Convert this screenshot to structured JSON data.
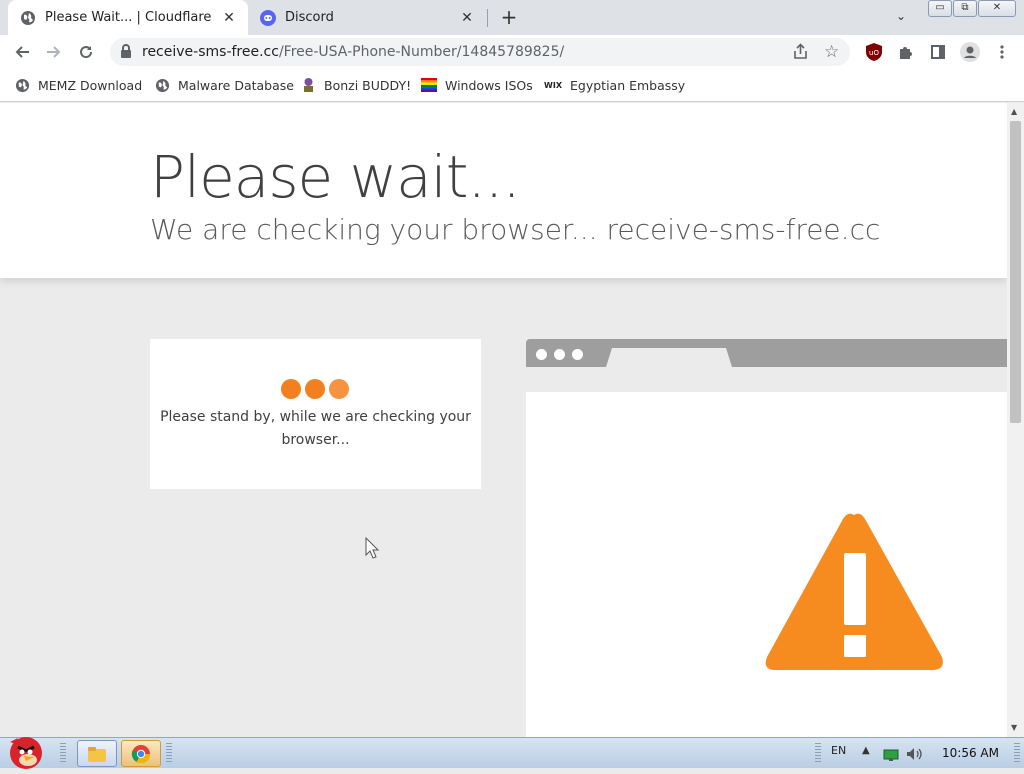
{
  "tabs": [
    {
      "title": "Please Wait... | Cloudflare",
      "icon": "globe-icon"
    },
    {
      "title": "Discord",
      "icon": "discord-icon"
    }
  ],
  "window_controls": {
    "minimize": "▭",
    "restore": "⧉",
    "close": "✕"
  },
  "address": {
    "host": "receive-sms-free.cc",
    "path": "/Free-USA-Phone-Number/14845789825/"
  },
  "bookmarks": [
    {
      "label": "MEMZ Download",
      "icon": "globe-icon"
    },
    {
      "label": "Malware Database",
      "icon": "globe-icon"
    },
    {
      "label": "Bonzi BUDDY!",
      "icon": "bonzi-icon"
    },
    {
      "label": "Windows ISOs",
      "icon": "rainbow-flag-icon"
    },
    {
      "label": "Egyptian Embassy",
      "icon": "wix-icon"
    }
  ],
  "page": {
    "title": "Please wait...",
    "subtitle": "We are checking your browser... receive-sms-free.cc",
    "card_text": "Please stand by, while we are checking your browser..."
  },
  "taskbar": {
    "lang": "EN",
    "time": "10:56 AM"
  },
  "colors": {
    "accent": "#f38020",
    "warning": "#f68b1f"
  }
}
